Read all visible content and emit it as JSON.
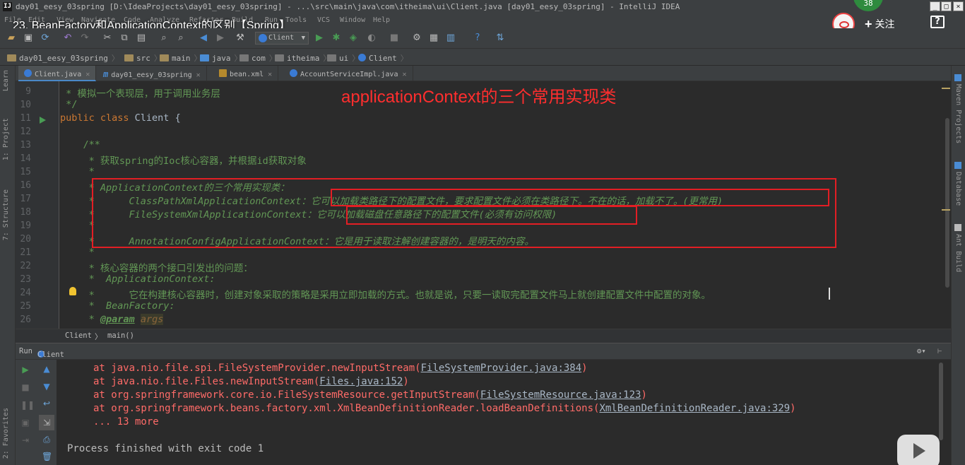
{
  "window": {
    "title": "day01_eesy_03spring [D:\\IdeaProjects\\day01_eesy_03spring] - ...\\src\\main\\java\\com\\itheima\\ui\\Client.java [day01_eesy_03spring] - IntelliJ IDEA",
    "logo": "IJ"
  },
  "menu": [
    "File",
    "Edit",
    "View",
    "Navigate",
    "Code",
    "Analyze",
    "Refactor",
    "Build",
    "Run",
    "Tools",
    "VCS",
    "Window",
    "Help"
  ],
  "overlay": {
    "video_title": "23. BeanFactory和ApplicationContext的区别【Spring】",
    "follow_label": "关注",
    "badge_count": "38"
  },
  "toolbar": {
    "run_config": "Client"
  },
  "breadcrumbs": [
    "day01_eesy_03spring",
    "src",
    "main",
    "java",
    "com",
    "itheima",
    "ui",
    "Client"
  ],
  "left_tabs": [
    "Learn",
    "1: Project",
    "7: Structure",
    "2: Favorites"
  ],
  "right_tabs": [
    "Maven Projects",
    "Database",
    "Ant Build"
  ],
  "tabs": [
    {
      "label": "Client.java"
    },
    {
      "label": "day01_eesy_03spring"
    },
    {
      "label": "bean.xml"
    },
    {
      "label": "AccountServiceImpl.java"
    }
  ],
  "annotation": "applicationContext的三个常用实现类",
  "code": {
    "line_numbers": [
      "9",
      "10",
      "11",
      "12",
      "13",
      "14",
      "15",
      "16",
      "17",
      "18",
      "19",
      "20",
      "21",
      "22",
      "23",
      "24",
      "25",
      "26"
    ],
    "l9": " * 模拟一个表现层，用于调用业务层",
    "l10": " */",
    "l11_kw": "public class ",
    "l11_rest": "Client {",
    "l13": "    /**",
    "l14": "     * 获取spring的Ioc核心容器，并根据id获取对象",
    "l15": "     *",
    "l16": "     * ApplicationContext的三个常用实现类：",
    "l17": "     *      ClassPathXmlApplicationContext：它可以加载类路径下的配置文件，要求配置文件必须在类路径下。不在的话，加载不了。(更常用)",
    "l18": "     *      FileSystemXmlApplicationContext：它可以加载磁盘任意路径下的配置文件(必须有访问权限)",
    "l19": "     *",
    "l20": "     *      AnnotationConfigApplicationContext：它是用于读取注解创建容器的，是明天的内容。",
    "l21": "     *",
    "l22": "     * 核心容器的两个接口引发出的问题：",
    "l23": "     *  ApplicationContext:",
    "l24": "     *      它在构建核心容器时，创建对象采取的策略是采用立即加载的方式。也就是说，只要一读取完配置文件马上就创建配置文件中配置的对象。",
    "l25": "     *  BeanFactory:",
    "l26_pre": "     * ",
    "l26_tag": "@param",
    "l26_arg": "args"
  },
  "code_crumbs": [
    "Client",
    "main()"
  ],
  "run": {
    "label": "Run",
    "config": "Client",
    "lines": [
      {
        "pre": "at java.nio.file.spi.FileSystemProvider.newInputStream(",
        "link": "FileSystemProvider.java:384",
        "post": ")"
      },
      {
        "pre": "at java.nio.file.Files.newInputStream(",
        "link": "Files.java:152",
        "post": ")"
      },
      {
        "pre": "at org.springframework.core.io.FileSystemResource.getInputStream(",
        "link": "FileSystemResource.java:123",
        "post": ")"
      },
      {
        "pre": "at org.springframework.beans.factory.xml.XmlBeanDefinitionReader.loadBeanDefinitions(",
        "link": "XmlBeanDefinitionReader.java:329",
        "post": ")"
      }
    ],
    "more": "... 13 more",
    "finished": "Process finished with exit code 1"
  },
  "colors": {
    "accent": "#e31e24",
    "background": "#2b2b2b",
    "comment": "#629755",
    "keyword": "#cc7832"
  },
  "icons": [
    "open-icon",
    "save-icon",
    "sync-icon",
    "undo-icon",
    "redo-icon",
    "cut-icon",
    "copy-icon",
    "paste-icon",
    "find-icon",
    "replace-icon",
    "back-icon",
    "forward-icon",
    "run-icon",
    "debug-icon",
    "coverage-icon",
    "stop-icon",
    "settings-icon",
    "structure-icon",
    "help-icon"
  ]
}
